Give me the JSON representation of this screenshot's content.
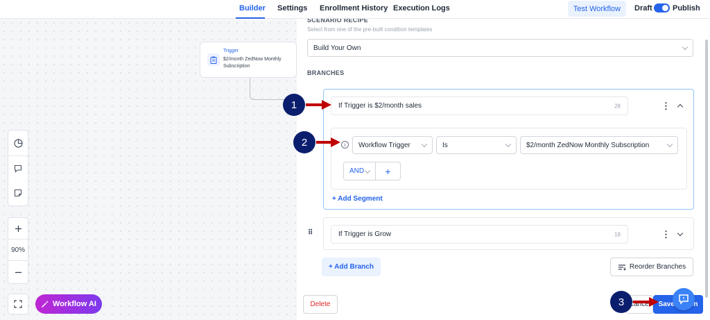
{
  "topbar": {
    "tabs": [
      "Builder",
      "Settings",
      "Enrollment History",
      "Execution Logs"
    ],
    "test_button": "Test Workflow",
    "draft_label": "Draft",
    "publish_label": "Publish"
  },
  "canvas": {
    "trigger_title": "Trigger",
    "trigger_desc": "$2/month ZedNow Monthly Subscription",
    "zoom": "90%",
    "workflow_ai": "Workflow AI"
  },
  "panel": {
    "scenario_title": "SCENARIO RECIPE",
    "scenario_sub": "Select from one of the pre-built condition templates",
    "scenario_value": "Build Your Own",
    "branches_title": "BRANCHES",
    "branch1": {
      "name": "If Trigger is $2/month sales",
      "count": "28",
      "field": "Workflow Trigger",
      "operator": "Is",
      "value": "$2/month ZedNow Monthly Subscription",
      "and_label": "AND",
      "add_segment": "+ Add Segment"
    },
    "branch2": {
      "name": "If Trigger is Grow",
      "count": "18"
    },
    "add_branch": "+ Add Branch",
    "reorder": "Reorder Branches",
    "delete": "Delete",
    "cancel": "Cancel",
    "save": "Save Action"
  },
  "annotations": {
    "step1": "1",
    "step2": "2",
    "step3": "3"
  },
  "colors": {
    "accent": "#2563eb",
    "annotation": "#0b1e6e",
    "arrow": "#c00000",
    "ai_gradient_start": "#c026d3",
    "ai_gradient_end": "#7c3aed"
  }
}
